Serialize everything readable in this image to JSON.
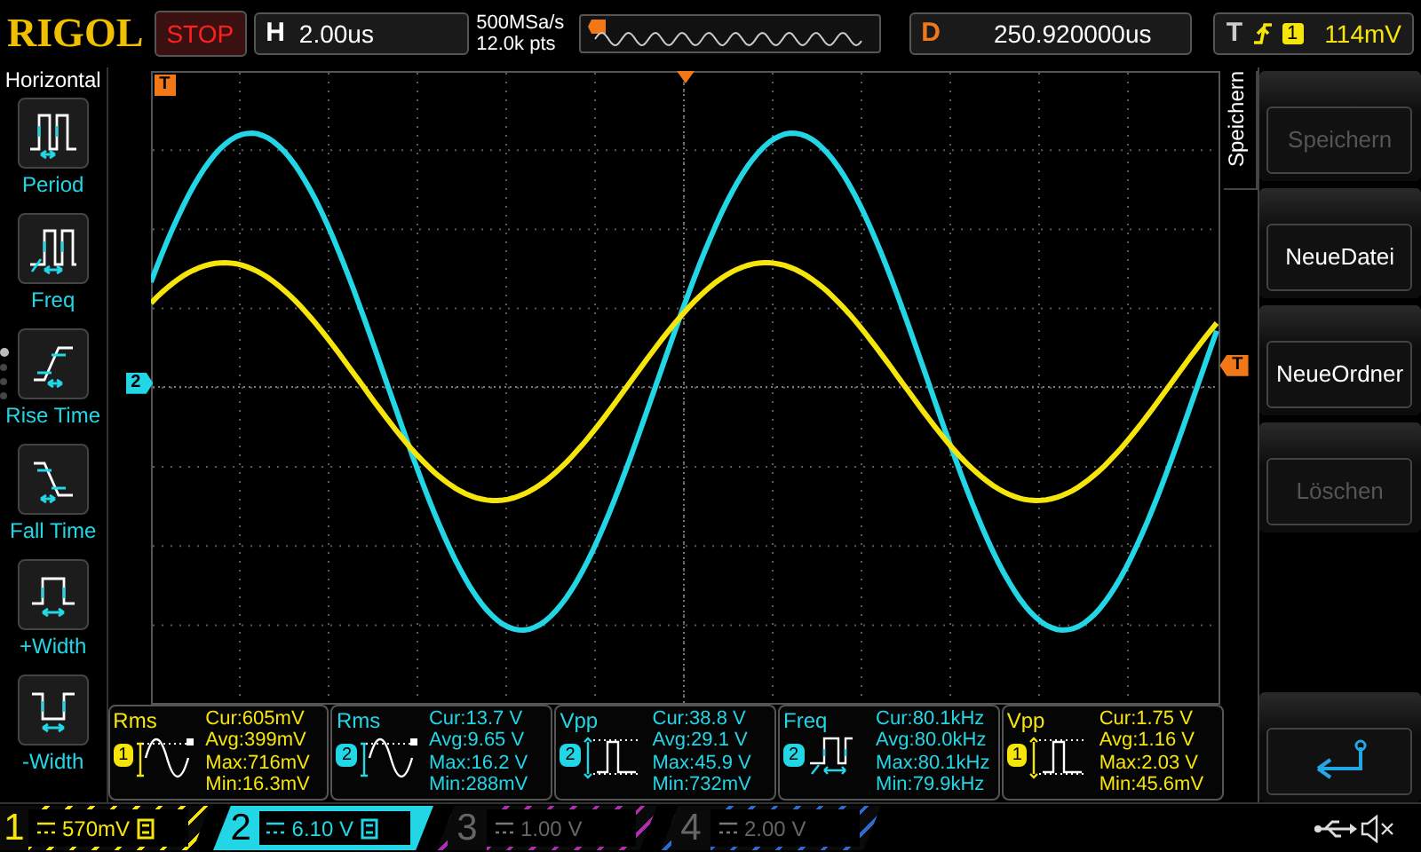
{
  "top_bar": {
    "logo": "RIGOL",
    "run_state": "STOP",
    "timebase": {
      "label": "H",
      "value": "2.00us"
    },
    "sample_rate": "500MSa/s",
    "memory_depth": "12.0k pts",
    "delay": {
      "label": "D",
      "value": "250.920000us"
    },
    "trigger": {
      "label": "T",
      "source": "1",
      "level": "114mV"
    }
  },
  "sidebar": {
    "title": "Horizontal",
    "items": [
      {
        "kind": "period",
        "label": "Period"
      },
      {
        "kind": "freq",
        "label": "Freq"
      },
      {
        "kind": "rise",
        "label": "Rise Time"
      },
      {
        "kind": "fall",
        "label": "Fall Time"
      },
      {
        "kind": "pwidth",
        "label": "+Width"
      },
      {
        "kind": "nwidth",
        "label": "-Width"
      }
    ],
    "pages": [
      {
        "selected": true
      },
      {
        "selected": false
      },
      {
        "selected": false
      },
      {
        "selected": false
      }
    ]
  },
  "screen": {
    "markers": [
      {
        "kind": "trigger_position",
        "label": "T"
      },
      {
        "kind": "channel",
        "label": "2"
      },
      {
        "kind": "trigger_level",
        "label": "T"
      }
    ]
  },
  "menu": {
    "title": "Speichern",
    "buttons": [
      {
        "kind": "text",
        "label": "Speichern",
        "disabled": true
      },
      {
        "kind": "text",
        "label": "NeueDatei",
        "disabled": false
      },
      {
        "kind": "text",
        "label": "NeueOrdner",
        "disabled": false
      },
      {
        "kind": "text",
        "label": "Löschen",
        "disabled": true
      },
      {
        "kind": "back"
      }
    ]
  },
  "measurements": [
    {
      "name": "Rms",
      "channel": "1",
      "color": "#f5e50a",
      "kind": "sine",
      "lines": [
        "Cur:605mV",
        "Avg:399mV",
        "Max:716mV",
        "Min:16.3mV"
      ]
    },
    {
      "name": "Rms",
      "channel": "2",
      "color": "#22d6e6",
      "kind": "sine",
      "lines": [
        "Cur:13.7 V",
        "Avg:9.65 V",
        "Max:16.2 V",
        "Min:288mV"
      ]
    },
    {
      "name": "Vpp",
      "channel": "2",
      "color": "#22d6e6",
      "kind": "pulse",
      "lines": [
        "Cur:38.8 V",
        "Avg:29.1 V",
        "Max:45.9 V",
        "Min:732mV"
      ]
    },
    {
      "name": "Freq",
      "channel": "2",
      "color": "#22d6e6",
      "kind": "freq",
      "lines": [
        "Cur:80.1kHz",
        "Avg:80.0kHz",
        "Max:80.1kHz",
        "Min:79.9kHz"
      ]
    },
    {
      "name": "Vpp",
      "channel": "1",
      "color": "#f5e50a",
      "kind": "pulse",
      "lines": [
        "Cur:1.75 V",
        "Avg:1.16 V",
        "Max:2.03 V",
        "Min:45.6mV"
      ]
    }
  ],
  "channels": [
    {
      "number": "1",
      "value": "570mV",
      "on": true,
      "selected": false,
      "color": "#f5e50a"
    },
    {
      "number": "2",
      "value": "6.10 V",
      "on": true,
      "selected": true,
      "color": "#22d6e6"
    },
    {
      "number": "3",
      "value": "1.00 V",
      "on": false,
      "selected": false,
      "color": "#b02cb0"
    },
    {
      "number": "4",
      "value": "2.00 V",
      "on": false,
      "selected": false,
      "color": "#2c6cd0"
    }
  ]
}
